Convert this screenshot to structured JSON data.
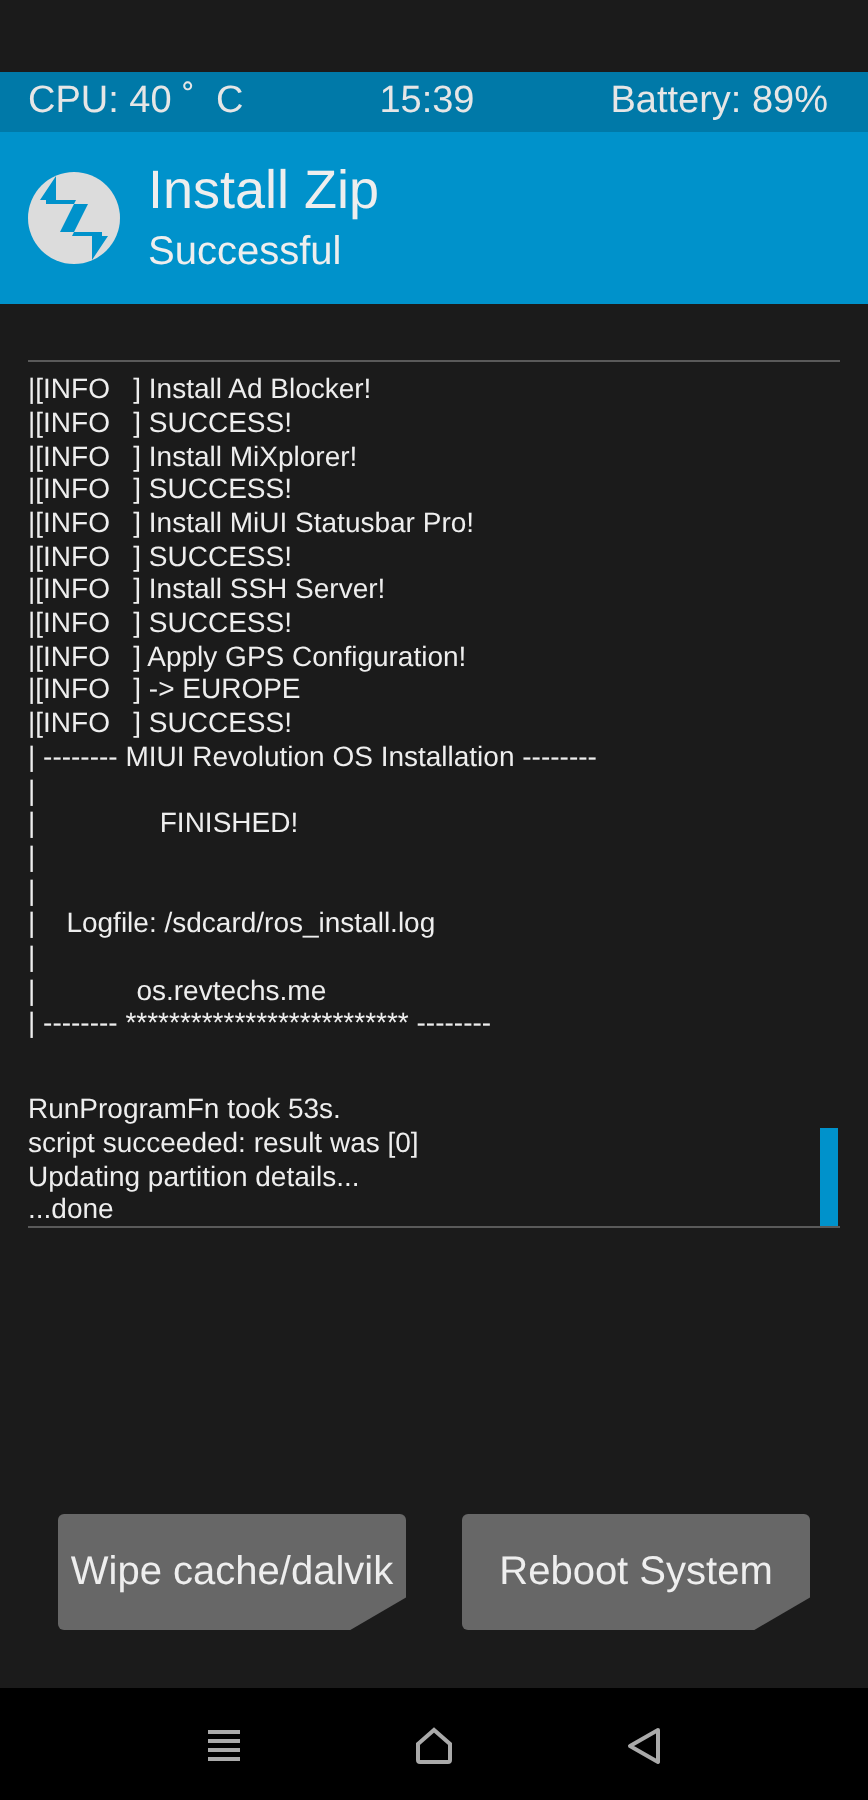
{
  "status_bar": {
    "cpu": "CPU: 40 ˚  C",
    "time": "15:39",
    "battery": "Battery: 89%"
  },
  "header": {
    "title": "Install Zip",
    "subtitle": "Successful"
  },
  "console": {
    "log_lines": [
      "|[INFO   ] Install Ad Blocker!",
      "|[INFO   ] SUCCESS!",
      "|[INFO   ] Install MiXplorer!",
      "|[INFO   ] SUCCESS!",
      "|[INFO   ] Install MiUI Statusbar Pro!",
      "|[INFO   ] SUCCESS!",
      "|[INFO   ] Install SSH Server!",
      "|[INFO   ] SUCCESS!",
      "|[INFO   ] Apply GPS Configuration!",
      "|[INFO   ] -> EUROPE",
      "|[INFO   ] SUCCESS!",
      "| -------- MIUI Revolution OS Installation --------",
      "|",
      "|                FINISHED!",
      "|",
      "|",
      "|    Logfile: /sdcard/ros_install.log",
      "|",
      "|             os.revtechs.me",
      "| -------- ************************** --------"
    ],
    "result_lines": [
      "RunProgramFn took 53s.",
      "script succeeded: result was [0]",
      "Updating partition details...",
      "...done"
    ]
  },
  "buttons": [
    "Wipe cache/dalvik",
    "Reboot System"
  ]
}
